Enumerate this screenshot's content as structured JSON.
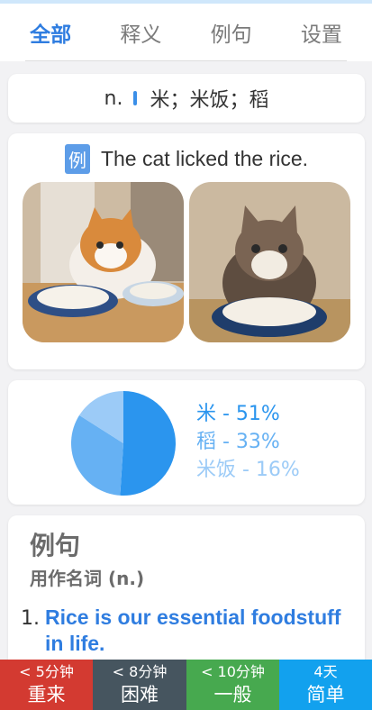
{
  "tabs": [
    {
      "label": "全部",
      "active": true
    },
    {
      "label": "释义",
      "active": false
    },
    {
      "label": "例句",
      "active": false
    },
    {
      "label": "设置",
      "active": false
    }
  ],
  "definition": {
    "pos": "n.",
    "text": "米；米饭；稻"
  },
  "example": {
    "badge": "例",
    "sentence": "The cat licked the rice."
  },
  "chart_data": {
    "type": "pie",
    "slices": [
      {
        "label": "米 - 51%",
        "value": 51,
        "color": "#2b95ee"
      },
      {
        "label": "稻 - 33%",
        "value": 33,
        "color": "#66b1f3"
      },
      {
        "label": "米饭 - 16%",
        "value": 16,
        "color": "#9ccbf7"
      }
    ]
  },
  "sentences": {
    "title": "例句",
    "subtitle": "用作名词 (n.)",
    "items": [
      {
        "num": "1.",
        "en": "Rice is our essential foodstuff in life."
      }
    ]
  },
  "buttons": [
    {
      "time": "< 5分钟",
      "label": "重来",
      "color": "#d33a31"
    },
    {
      "time": "< 8分钟",
      "label": "困难",
      "color": "#46555f"
    },
    {
      "time": "< 10分钟",
      "label": "一般",
      "color": "#47a94f"
    },
    {
      "time": "4天",
      "label": "简单",
      "color": "#12a1ee"
    }
  ]
}
